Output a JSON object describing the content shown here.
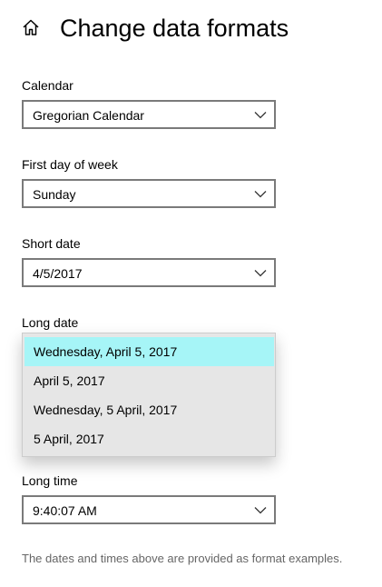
{
  "header": {
    "home_icon": "home-icon",
    "title": "Change data formats"
  },
  "fields": {
    "calendar": {
      "label": "Calendar",
      "value": "Gregorian Calendar"
    },
    "first_day_of_week": {
      "label": "First day of week",
      "value": "Sunday"
    },
    "short_date": {
      "label": "Short date",
      "value": "4/5/2017"
    },
    "long_date": {
      "label": "Long date",
      "options": [
        "Wednesday, April 5, 2017",
        "April 5, 2017",
        "Wednesday, 5 April, 2017",
        "5 April, 2017"
      ],
      "selected_index": 0
    },
    "long_time": {
      "label": "Long time",
      "value": "9:40:07 AM"
    }
  },
  "footnote": "The dates and times above are provided as format examples.",
  "icons": {
    "dropdown_chevron": "chevron-down-icon"
  },
  "colors": {
    "selected_option_bg": "#a6f5f7",
    "dropdown_bg": "#e6e6e6",
    "combo_border": "#7a7a7a",
    "footnote_text": "#666666"
  }
}
